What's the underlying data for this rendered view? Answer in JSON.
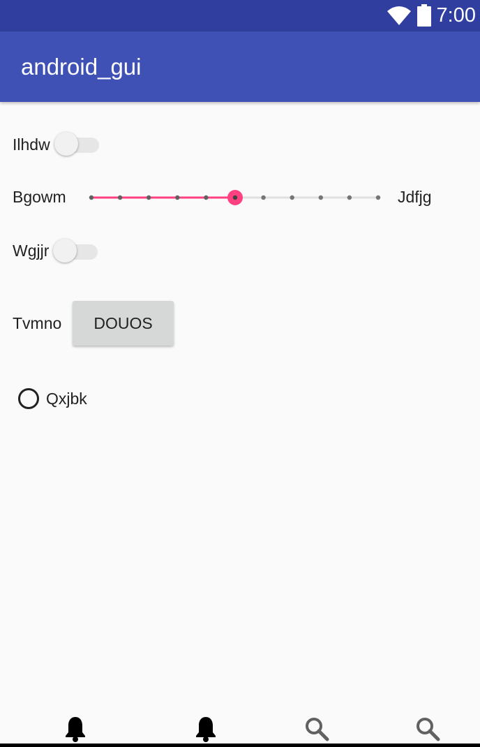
{
  "status_bar": {
    "time": "7:00",
    "icons": [
      "wifi-icon",
      "battery-icon"
    ],
    "background": "#303f9f"
  },
  "app_bar": {
    "title": "android_gui",
    "background": "#3f51b5"
  },
  "rows": {
    "switch1": {
      "label": "Ilhdw",
      "checked": false
    },
    "seekbar": {
      "start_label": "Bgowm",
      "end_label": "Jdfjg",
      "steps": 10,
      "value": 5,
      "accent": "#ff4081"
    },
    "switch2": {
      "label": "Wgjjr",
      "checked": false
    },
    "button_row": {
      "label": "Tvmno",
      "button_label": "DOUOS"
    },
    "radio": {
      "label": "Qxjbk",
      "checked": false
    }
  },
  "bottom_nav": {
    "items": [
      {
        "icon": "bell-icon"
      },
      {
        "icon": "bell-icon"
      },
      {
        "icon": "search-icon"
      },
      {
        "icon": "search-icon"
      }
    ]
  }
}
